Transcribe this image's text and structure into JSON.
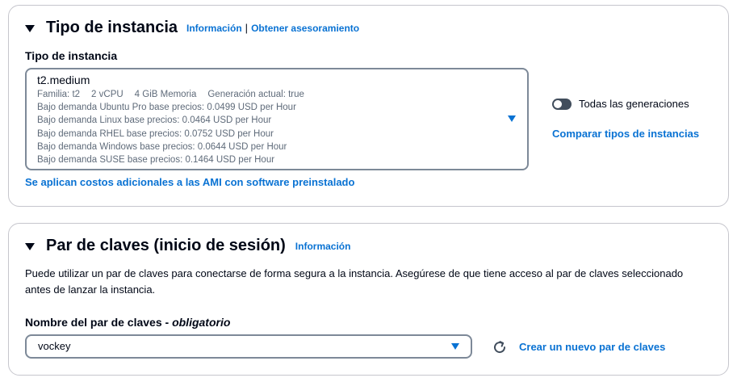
{
  "instance_section": {
    "title": "Tipo de instancia",
    "info_link": "Información",
    "separator": "|",
    "advice_link": "Obtener asesoramiento",
    "field_label": "Tipo de instancia",
    "selected": {
      "name": "t2.medium",
      "family": "Familia: t2",
      "vcpu": "2 vCPU",
      "memory": "4 GiB Memoria",
      "generation": "Generación actual: true",
      "prices": [
        "Bajo demanda Ubuntu Pro base precios: 0.0499 USD per Hour",
        "Bajo demanda Linux base precios: 0.0464 USD per Hour",
        "Bajo demanda RHEL base precios: 0.0752 USD per Hour",
        "Bajo demanda Windows base precios: 0.0644 USD per Hour",
        "Bajo demanda SUSE base precios: 0.1464 USD per Hour"
      ]
    },
    "toggle_label": "Todas las generaciones",
    "toggle_on": false,
    "compare_link": "Comparar tipos de instancias",
    "ami_link": "Se aplican costos adicionales a las AMI con software preinstalado"
  },
  "keypair_section": {
    "title": "Par de claves (inicio de sesión)",
    "info_link": "Información",
    "description": "Puede utilizar un par de claves para conectarse de forma segura a la instancia. Asegúrese de que tiene acceso al par de claves seleccionado antes de lanzar la instancia.",
    "field_label": "Nombre del par de claves - ",
    "field_required": "obligatorio",
    "selected": "vockey",
    "create_link": "Crear un nuevo par de claves"
  },
  "colors": {
    "link": "#0972d3",
    "text": "#000716",
    "secondary_text": "#5f6b7a",
    "border": "#7d8998",
    "toggle_off": "#414d5c"
  },
  "icons": {
    "section_caret": "caret-down-icon",
    "dropdown": "triangle-down-icon",
    "refresh": "refresh-icon"
  }
}
